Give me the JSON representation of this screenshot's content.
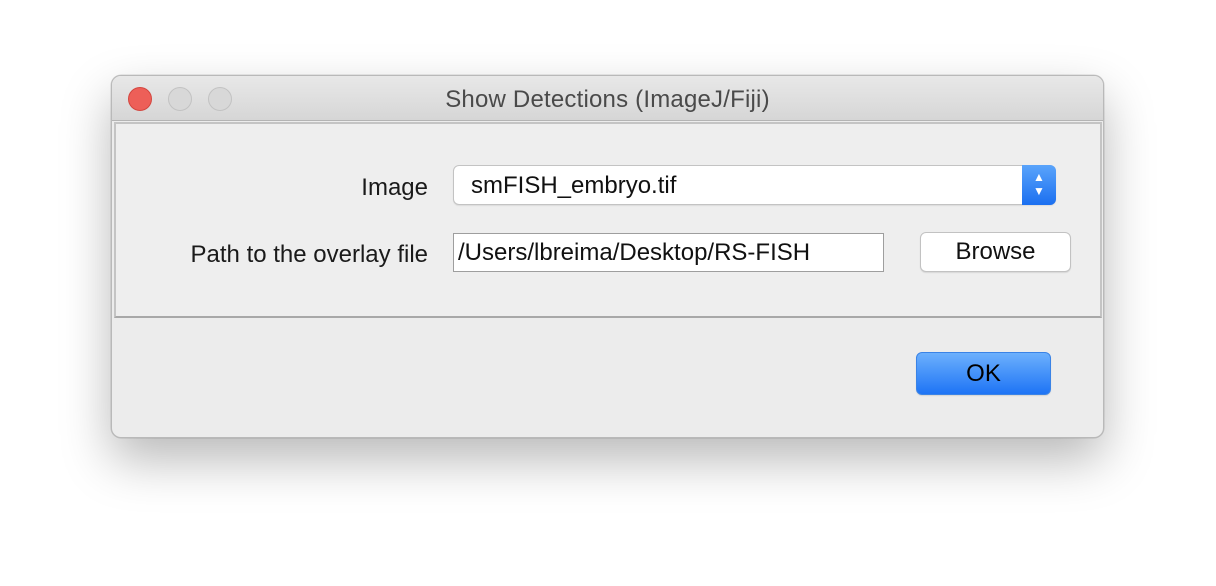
{
  "window": {
    "title": "Show Detections (ImageJ/Fiji)"
  },
  "form": {
    "image_label": "Image",
    "image_selected": "smFISH_embryo.tif",
    "path_label": "Path to the overlay file",
    "path_value": "/Users/lbreima/Desktop/RS-FISH",
    "browse_label": "Browse"
  },
  "footer": {
    "ok_label": "OK"
  },
  "colors": {
    "close": "#ed5f58",
    "accent": "#1e74f5"
  }
}
